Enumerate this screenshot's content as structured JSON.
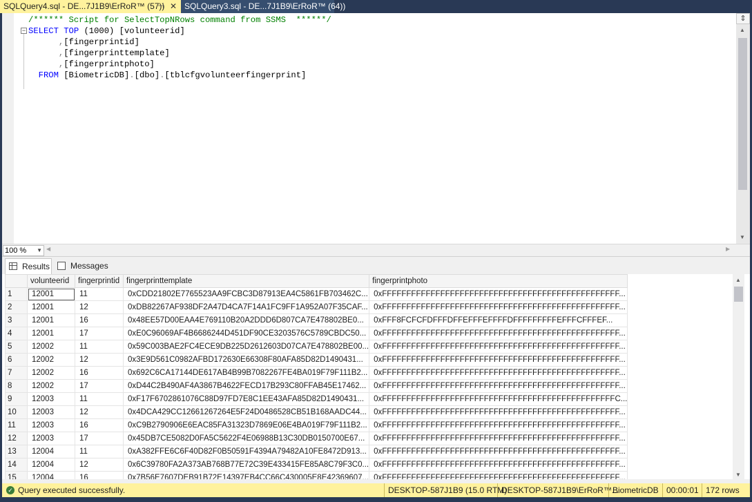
{
  "tabs": [
    {
      "label": "SQLQuery4.sql - DE...7J1B9\\ErRoR™ (57))",
      "pin": "⊣",
      "close": "✕"
    },
    {
      "label": "SQLQuery3.sql - DE...7J1B9\\ErRoR™ (64))"
    }
  ],
  "editor": {
    "lines": [
      {
        "parts": [
          [
            "cm",
            "/****** Script for SelectTopNRows command from SSMS  ******/"
          ]
        ]
      },
      {
        "parts": [
          [
            "kw",
            "SELECT"
          ],
          [
            "",
            " "
          ],
          [
            "kw",
            "TOP"
          ],
          [
            "",
            " (1000) [volunteerid]"
          ]
        ]
      },
      {
        "parts": [
          [
            "",
            "      "
          ],
          [
            "op",
            ","
          ],
          [
            "",
            "[fingerprintid]"
          ]
        ]
      },
      {
        "parts": [
          [
            "",
            "      "
          ],
          [
            "op",
            ","
          ],
          [
            "",
            "[fingerprinttemplate]"
          ]
        ]
      },
      {
        "parts": [
          [
            "",
            "      "
          ],
          [
            "op",
            ","
          ],
          [
            "",
            "[fingerprintphoto]"
          ]
        ]
      },
      {
        "parts": [
          [
            "",
            "  "
          ],
          [
            "kw",
            "FROM"
          ],
          [
            "",
            " [BiometricDB]"
          ],
          [
            "op",
            "."
          ],
          [
            "",
            "[dbo]"
          ],
          [
            "op",
            "."
          ],
          [
            "",
            "[tblcfgvolunteerfingerprint]"
          ]
        ]
      }
    ]
  },
  "zoom": {
    "value": "100 %"
  },
  "result_tabs": {
    "results": "Results",
    "messages": "Messages"
  },
  "grid": {
    "columns": [
      "volunteerid",
      "fingerprintid",
      "fingerprinttemplate",
      "fingerprintphoto"
    ],
    "rows": [
      [
        "1",
        "12001",
        "11",
        "0xCDD21802E7765523AA9FCBC3D87913EA4C5861FB703462C...",
        "0xFFFFFFFFFFFFFFFFFFFFFFFFFFFFFFFFFFFFFFFFFFFFFFFFF..."
      ],
      [
        "2",
        "12001",
        "12",
        "0xDB82267AF938DF2A47D4CA7F14A1FC9FF1A952A07F35CAF...",
        "0xFFFFFFFFFFFFFFFFFFFFFFFFFFFFFFFFFFFFFFFFFFFFFFFFF..."
      ],
      [
        "3",
        "12001",
        "16",
        "0x48EE57D00EAA4E769110B20A2DDD6D807CA7E478802BE0...",
        "0xFFF8FCFCFDFFFDFFEFFFEFFFFDFFFFFFFFFEFFFCFFFEF..."
      ],
      [
        "4",
        "12001",
        "17",
        "0xE0C96069AF4B6686244D451DF90CE3203576C5789CBDC50...",
        "0xFFFFFFFFFFFFFFFFFFFFFFFFFFFFFFFFFFFFFFFFFFFFFFFFF..."
      ],
      [
        "5",
        "12002",
        "11",
        "0x59C003BAE2FC4ECE9DB225D2612603D07CA7E478802BE00...",
        "0xFFFFFFFFFFFFFFFFFFFFFFFFFFFFFFFFFFFFFFFFFFFFFFFFF..."
      ],
      [
        "6",
        "12002",
        "12",
        "0x3E9D561C0982AFBD172630E66308F80AFA85D82D1490431...",
        "0xFFFFFFFFFFFFFFFFFFFFFFFFFFFFFFFFFFFFFFFFFFFFFFFFF..."
      ],
      [
        "7",
        "12002",
        "16",
        "0x692C6CA17144DE617AB4B99B7082267FE4BA019F79F111B2...",
        "0xFFFFFFFFFFFFFFFFFFFFFFFFFFFFFFFFFFFFFFFFFFFFFFFFF..."
      ],
      [
        "8",
        "12002",
        "17",
        "0xD44C2B490AF4A3867B4622FECD17B293C80FFAB45E17462...",
        "0xFFFFFFFFFFFFFFFFFFFFFFFFFFFFFFFFFFFFFFFFFFFFFFFFF..."
      ],
      [
        "9",
        "12003",
        "11",
        "0xF17F6702861076C88D97FD7E8C1EE43AFA85D82D1490431...",
        "0xFFFFFFFFFFFFFFFFFFFFFFFFFFFFFFFFFFFFFFFFFFFFFFFFC..."
      ],
      [
        "10",
        "12003",
        "12",
        "0x4DCA429CC12661267264E5F24D0486528CB51B168AADC44...",
        "0xFFFFFFFFFFFFFFFFFFFFFFFFFFFFFFFFFFFFFFFFFFFFFFFFF..."
      ],
      [
        "11",
        "12003",
        "16",
        "0xC9B2790906E6EAC85FA31323D7869E06E4BA019F79F111B2...",
        "0xFFFFFFFFFFFFFFFFFFFFFFFFFFFFFFFFFFFFFFFFFFFFFFFFF..."
      ],
      [
        "12",
        "12003",
        "17",
        "0x45DB7CE5082D0FA5C5622F4E06988B13C30DB0150700E67...",
        "0xFFFFFFFFFFFFFFFFFFFFFFFFFFFFFFFFFFFFFFFFFFFFFFFFF..."
      ],
      [
        "13",
        "12004",
        "11",
        "0xA382FFE6C6F40D82F0B50591F4394A79482A10FE8472D913...",
        "0xFFFFFFFFFFFFFFFFFFFFFFFFFFFFFFFFFFFFFFFFFFFFFFFFF..."
      ],
      [
        "14",
        "12004",
        "12",
        "0x6C39780FA2A373AB768B77E72C39E433415FE85A8C79F3C0...",
        "0xFFFFFFFFFFFFFFFFFFFFFFFFFFFFFFFFFFFFFFFFFFFFFFFFF..."
      ],
      [
        "15",
        "12004",
        "16",
        "0x7B56E7607DEB91B72E14397EB4CC66C430005E8E42369607...",
        "0xFFFFFFFFFFFFFFFFFFFFFFFFFFFFFFFFFFFFFFFFFFFFFFFFF..."
      ]
    ]
  },
  "status": {
    "message": "Query executed successfully.",
    "server": "DESKTOP-587J1B9 (15.0 RTM)",
    "login": "DESKTOP-587J1B9\\ErRoR™...",
    "database": "BiometricDB",
    "elapsed": "00:00:01",
    "rows": "172 rows"
  },
  "colors": {
    "active_tab": "#fff29d",
    "keyword": "#0000ff",
    "comment": "#008000",
    "frame": "#293955"
  }
}
